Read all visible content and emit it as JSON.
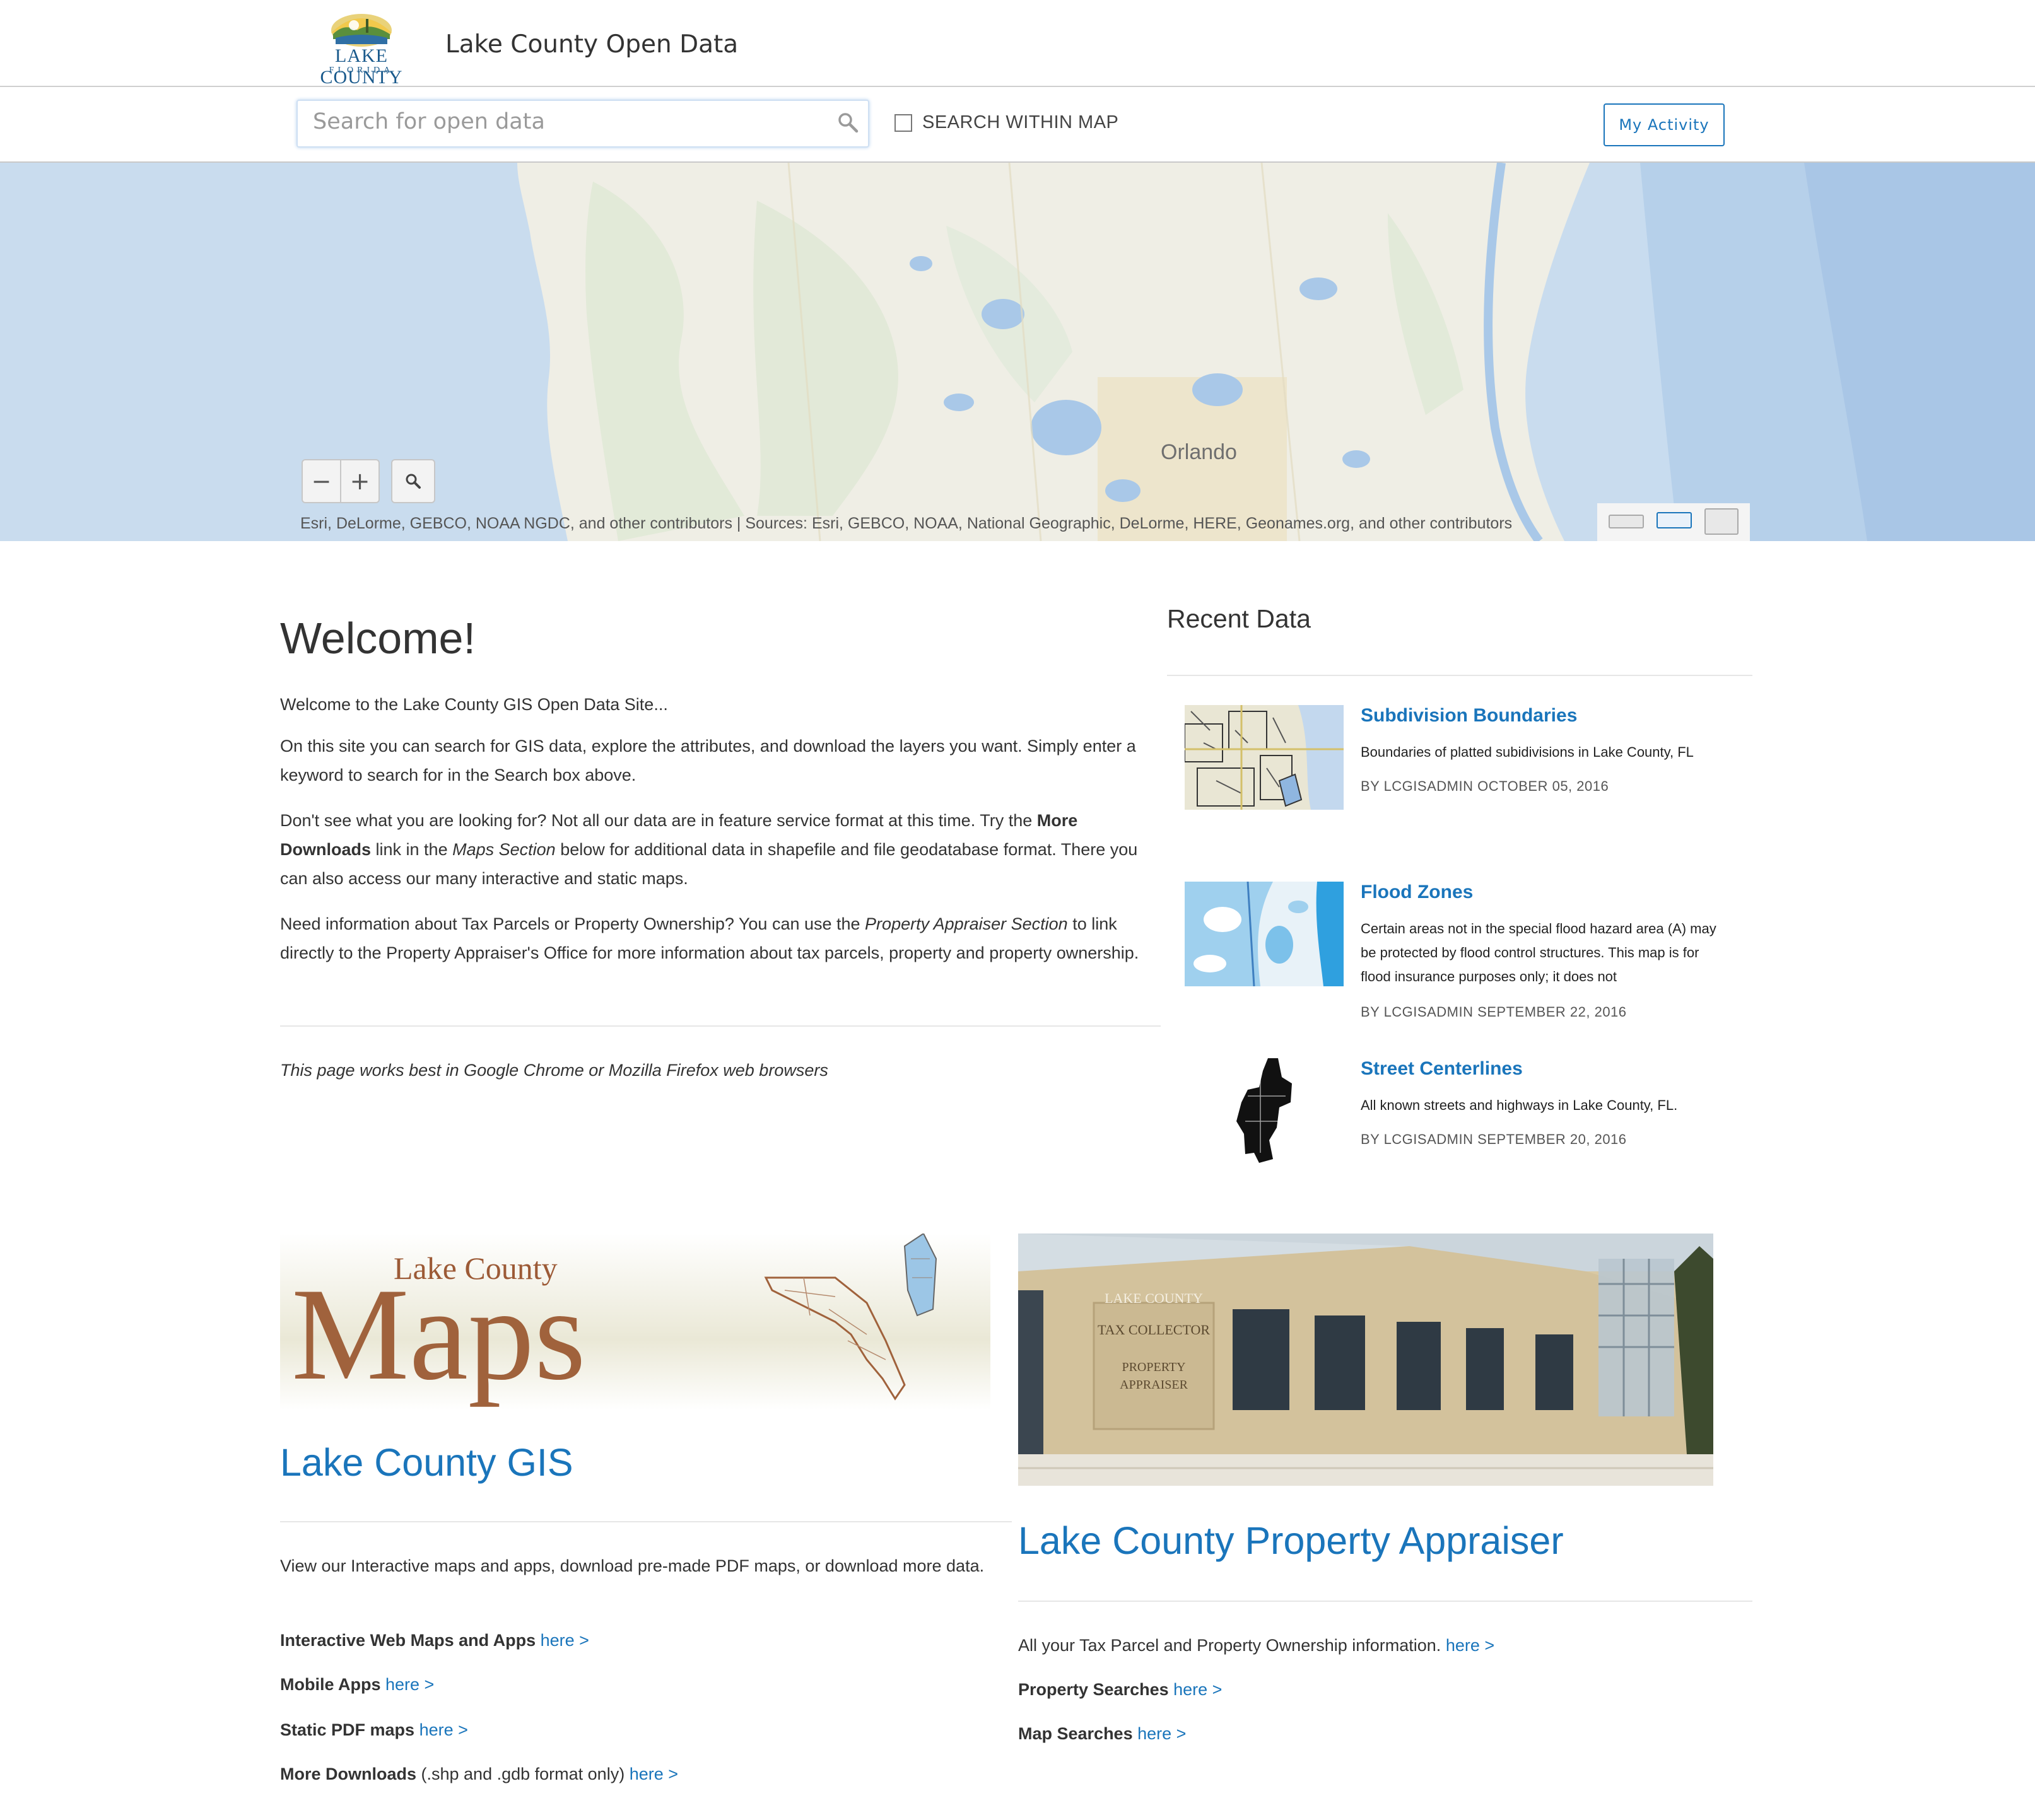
{
  "header": {
    "logo_text": "LAKE COUNTY",
    "logo_sub": "FLORIDA",
    "site_title": "Lake County Open Data"
  },
  "search": {
    "placeholder": "Search for open data",
    "value": "",
    "within_map_label": "SEARCH WITHIN MAP",
    "within_map_checked": false,
    "my_activity_label": "My Activity"
  },
  "map": {
    "city_label": "Orlando",
    "zoom_out": "−",
    "zoom_in": "+",
    "attribution": "Esri, DeLorme, GEBCO, NOAA NGDC, and other contributors |  Sources: Esri, GEBCO, NOAA, National Geographic, DeLorme, HERE, Geonames.org, and other contributors"
  },
  "welcome": {
    "title": "Welcome!",
    "intro": "Welcome to the Lake County GIS Open Data Site...",
    "p1": "On this site you can search for GIS data, explore the attributes, and download the layers you want. Simply enter a keyword to search for in the Search box above.",
    "p2_a": "Don't see what you are looking for? Not all our data are in feature service format at this time. Try the ",
    "p2_b": "More Downloads",
    "p2_c": " link in the ",
    "p2_d": "Maps Section",
    "p2_e": " below for additional data in shapefile and file geodatabase format. There you can also access our many interactive and static maps.",
    "p3_a": "Need information about Tax Parcels or Property Ownership? You can use the ",
    "p3_b": "Property Appraiser Section",
    "p3_c": " to link directly to the Property Appraiser's Office for more information about tax parcels, property and property ownership.",
    "browser_note": "This page works best in Google Chrome or Mozilla Firefox web browsers"
  },
  "recent": {
    "title": "Recent Data",
    "items": [
      {
        "title": "Subdivision Boundaries",
        "description": "Boundaries of platted subidivisions in Lake County, FL",
        "meta": "BY LCGISADMIN OCTOBER 05, 2016"
      },
      {
        "title": "Flood Zones",
        "description": "Certain areas not in the special flood hazard area (A) may be protected by flood control structures. This map is for flood insurance purposes only; it does not",
        "meta": "BY LCGISADMIN SEPTEMBER 22, 2016"
      },
      {
        "title": "Street Centerlines",
        "description": "All known streets and highways in Lake County, FL.",
        "meta": "BY LCGISADMIN SEPTEMBER 20, 2016"
      }
    ]
  },
  "gis": {
    "banner_small": "Lake County",
    "banner_big": "Maps",
    "title": "Lake County GIS",
    "description": "View our Interactive maps and apps, download pre-made PDF maps, or download more data.",
    "links": [
      {
        "label": "Interactive Web Maps and Apps",
        "suffix": "",
        "link": "here >"
      },
      {
        "label": "Mobile Apps",
        "suffix": "",
        "link": "here >"
      },
      {
        "label": "Static PDF maps",
        "suffix": "",
        "link": "here >"
      },
      {
        "label": "More Downloads",
        "suffix": " (.shp and .gdb format only)",
        "link": "here >"
      }
    ]
  },
  "pa": {
    "sign_1": "LAKE COUNTY",
    "sign_2": "TAX COLLECTOR",
    "sign_3": "PROPERTY",
    "sign_4": "APPRAISER",
    "title": "Lake County Property Appraiser",
    "description": "All your Tax Parcel and Property Ownership information.",
    "description_link": "here >",
    "links": [
      {
        "label": "Property Searches",
        "link": "here >"
      },
      {
        "label": "Map Searches",
        "link": "here >"
      }
    ]
  },
  "colors": {
    "link": "#1a75bb",
    "map_water": "#c6dbf0",
    "map_land": "#f0efe6"
  }
}
